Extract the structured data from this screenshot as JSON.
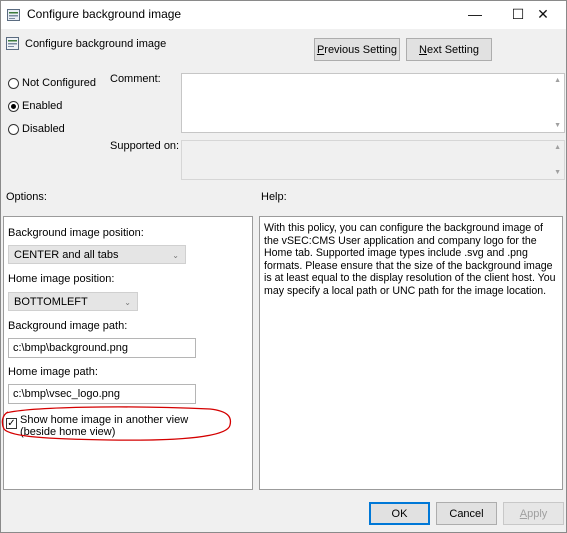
{
  "window": {
    "title": "Configure background image",
    "minimize_glyph": "—",
    "maximize_glyph": "☐",
    "close_glyph": "✕"
  },
  "header": {
    "setting_name": "Configure background image",
    "previous_setting_label": "Previous Setting",
    "next_setting_label": "Next Setting"
  },
  "state": {
    "options": [
      {
        "label": "Not Configured",
        "selected": false
      },
      {
        "label": "Enabled",
        "selected": true
      },
      {
        "label": "Disabled",
        "selected": false
      }
    ],
    "comment_label": "Comment:",
    "supported_on_label": "Supported on:"
  },
  "options_panel": {
    "heading": "Options:",
    "bg_position_label": "Background image position:",
    "bg_position_value": "CENTER and all tabs",
    "home_position_label": "Home image position:",
    "home_position_value": "BOTTOMLEFT",
    "bg_path_label": "Background image path:",
    "bg_path_value": "c:\\bmp\\background.png",
    "home_path_label": "Home image path:",
    "home_path_value": "c:\\bmp\\vsec_logo.png",
    "show_home_label": "Show home image in another view (beside home view)",
    "show_home_checked": true
  },
  "help_panel": {
    "heading": "Help:",
    "text": "With this policy, you can configure the background image of the vSEC:CMS User application and company logo for the Home tab. Supported image types include .svg and .png formats. Please ensure that the size of the background image is at least equal to the display resolution of the client host. You may specify a local path or UNC path for the image location."
  },
  "footer": {
    "ok_label": "OK",
    "cancel_label": "Cancel",
    "apply_label": "Apply"
  },
  "colors": {
    "highlight_ellipse": "#d40000",
    "default_button_border": "#0078d7"
  }
}
